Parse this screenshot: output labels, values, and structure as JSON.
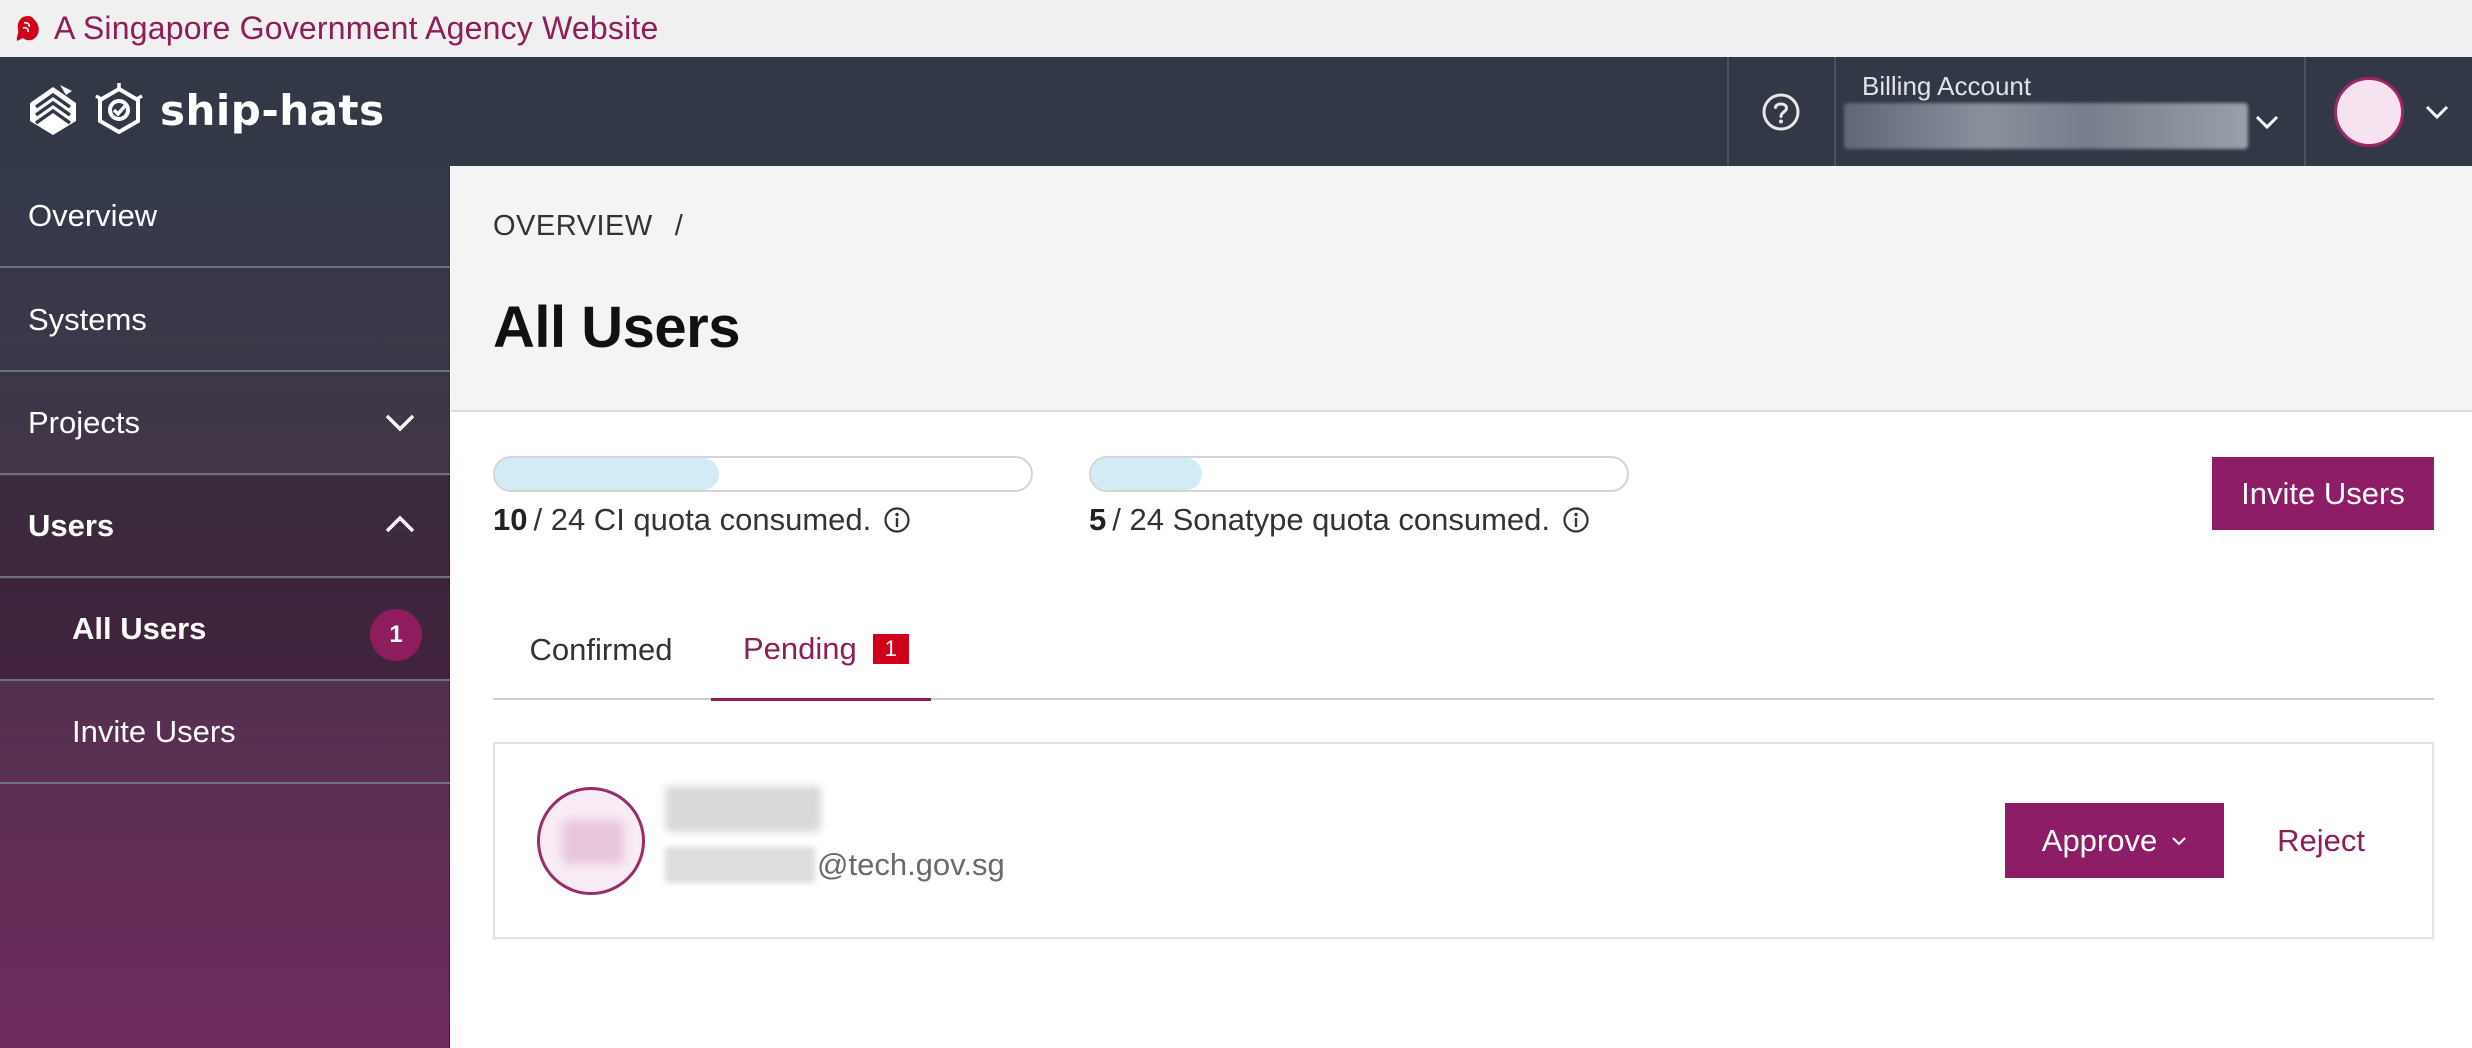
{
  "masthead": {
    "text": "A Singapore Government Agency Website",
    "icon": "lion-head-icon"
  },
  "brand": {
    "name": "ship-hats",
    "logos": [
      "govtech-crest-icon",
      "ship-hats-logo-icon"
    ]
  },
  "header": {
    "help_icon": "question-circle-icon",
    "billing": {
      "label": "Billing Account",
      "value": "",
      "icon": "chevron-down-icon"
    },
    "user_menu": {
      "icon": "chevron-down-icon"
    }
  },
  "sidebar": {
    "items": [
      {
        "label": "Overview"
      },
      {
        "label": "Systems"
      },
      {
        "label": "Projects",
        "icon": "chevron-down-icon"
      },
      {
        "label": "Users",
        "icon": "chevron-up-icon"
      },
      {
        "label": "All Users",
        "badge": "1"
      },
      {
        "label": "Invite Users"
      }
    ]
  },
  "page": {
    "breadcrumb": {
      "item": "OVERVIEW",
      "separator": "/"
    },
    "title": "All Users"
  },
  "quotas": [
    {
      "used": "10",
      "rest": "/ 24 CI quota consumed.",
      "fraction": 0.417,
      "icon": "info-icon"
    },
    {
      "used": "5",
      "rest": "/ 24 Sonatype quota consumed.",
      "fraction": 0.208,
      "icon": "info-icon"
    }
  ],
  "actions": {
    "invite_label": "Invite Users"
  },
  "tabs": [
    {
      "label": "Confirmed"
    },
    {
      "label": "Pending",
      "badge": "1",
      "selected": true
    }
  ],
  "pending_user": {
    "name": "",
    "email_domain": "@tech.gov.sg",
    "approve_label": "Approve",
    "reject_label": "Reject"
  },
  "colors": {
    "accent": "#8e1d68",
    "nav_bg": "#323846",
    "badge_red": "#d0021b",
    "quota_fill": "#d3ebf5"
  }
}
